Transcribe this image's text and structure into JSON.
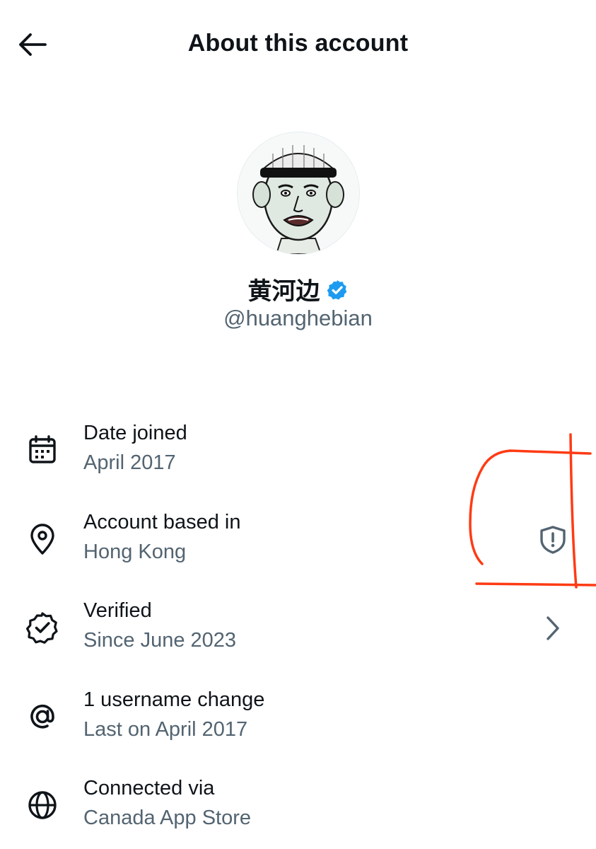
{
  "header": {
    "title": "About this account",
    "back_icon": "arrow-left-icon"
  },
  "profile": {
    "display_name": "黄河边",
    "handle": "@huanghebian",
    "verified": true,
    "verified_color": "#1d9bf0",
    "avatar_icon": "caricature-avatar"
  },
  "rows": [
    {
      "icon": "calendar-icon",
      "label": "Date joined",
      "value": "April 2017"
    },
    {
      "icon": "location-pin-icon",
      "label": "Account based in",
      "value": "Hong Kong",
      "trailing_icon": "shield-alert-icon"
    },
    {
      "icon": "verified-seal-icon",
      "label": "Verified",
      "value": "Since June 2023",
      "trailing_icon": "chevron-right-icon"
    },
    {
      "icon": "at-sign-icon",
      "label": "1 username change",
      "value": "Last on April 2017"
    },
    {
      "icon": "globe-icon",
      "label": "Connected via",
      "value": "Canada App Store"
    }
  ],
  "colors": {
    "text_primary": "#0f1419",
    "text_secondary": "#536471",
    "annotation": "#ff3b14"
  }
}
